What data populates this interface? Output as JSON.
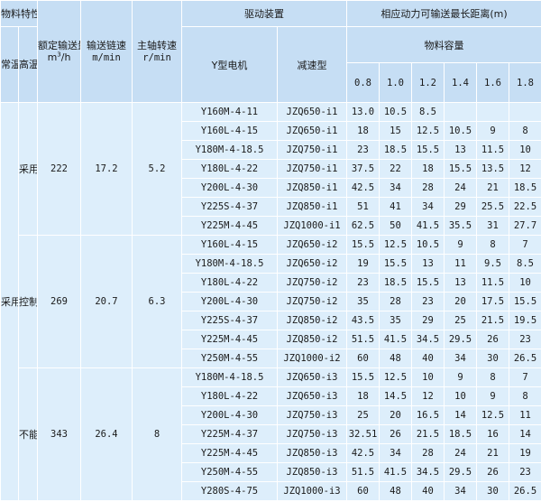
{
  "header": {
    "material_prop": "物料特性",
    "temp_normal": "常温琢磨性小",
    "temp_high": "高温琢磨性大",
    "rated_volume": "额定输送量",
    "rated_volume_unit_pre": "m",
    "rated_volume_unit_sup": "3",
    "rated_volume_unit_post": "/h",
    "chain_speed": "输送链速",
    "chain_speed_unit": "m/min",
    "spindle_speed": "主轴转速",
    "spindle_speed_unit": "r/min",
    "drive": "驱动装置",
    "motor": "Y型电机",
    "reducer": "减速型",
    "max_distance": "相应动力可输送最长距离(m)",
    "capacity": "物料容量",
    "capacity_values": [
      "0.8",
      "1.0",
      "1.2",
      "1.4",
      "1.6",
      "1.8"
    ]
  },
  "col_normal_label": "采用",
  "groups": [
    {
      "high_temp_label": "采用",
      "volume": "222",
      "chain_speed": "17.2",
      "spindle_speed": "5.2",
      "rows": [
        {
          "motor": "Y160M-4-11",
          "reducer": "JZQ650-i1",
          "values": [
            "13.0",
            "10.5",
            "8.5",
            "",
            "",
            ""
          ]
        },
        {
          "motor": "Y160L-4-15",
          "reducer": "JZQ650-i1",
          "values": [
            "18",
            "15",
            "12.5",
            "10.5",
            "9",
            "8"
          ]
        },
        {
          "motor": "Y180M-4-18.5",
          "reducer": "JZQ750-i1",
          "values": [
            "23",
            "18.5",
            "15.5",
            "13",
            "11.5",
            "10"
          ]
        },
        {
          "motor": "Y180L-4-22",
          "reducer": "JZQ750-i1",
          "values": [
            "37.5",
            "22",
            "18",
            "15.5",
            "13.5",
            "12"
          ]
        },
        {
          "motor": "Y200L-4-30",
          "reducer": "JZQ850-i1",
          "values": [
            "42.5",
            "34",
            "28",
            "24",
            "21",
            "18.5"
          ]
        },
        {
          "motor": "Y225S-4-37",
          "reducer": "JZQ850-i1",
          "values": [
            "51",
            "41",
            "34",
            "29",
            "25.5",
            "22.5"
          ]
        },
        {
          "motor": "Y225M-4-45",
          "reducer": "JZQ1000-i1",
          "values": [
            "62.5",
            "50",
            "41.5",
            "35.5",
            "31",
            "27.7"
          ]
        }
      ]
    },
    {
      "high_temp_label": "控制采用",
      "volume": "269",
      "chain_speed": "20.7",
      "spindle_speed": "6.3",
      "rows": [
        {
          "motor": "Y160L-4-15",
          "reducer": "JZQ650-i2",
          "values": [
            "15.5",
            "12.5",
            "10.5",
            "9",
            "8",
            "7"
          ]
        },
        {
          "motor": "Y180M-4-18.5",
          "reducer": "JZQ650-i2",
          "values": [
            "19",
            "15.5",
            "13",
            "11",
            "9.5",
            "8.5"
          ]
        },
        {
          "motor": "Y180L-4-22",
          "reducer": "JZQ750-i2",
          "values": [
            "23",
            "18.5",
            "15.5",
            "13",
            "11.5",
            "10"
          ]
        },
        {
          "motor": "Y200L-4-30",
          "reducer": "JZQ750-i2",
          "values": [
            "35",
            "28",
            "23",
            "20",
            "17.5",
            "15.5"
          ]
        },
        {
          "motor": "Y225S-4-37",
          "reducer": "JZQ850-i2",
          "values": [
            "43.5",
            "35",
            "29",
            "25",
            "21.5",
            "19.5"
          ]
        },
        {
          "motor": "Y225M-4-45",
          "reducer": "JZQ850-i2",
          "values": [
            "51.5",
            "41.5",
            "34.5",
            "29.5",
            "26",
            "23"
          ]
        },
        {
          "motor": "Y250M-4-55",
          "reducer": "JZQ1000-i2",
          "values": [
            "60",
            "48",
            "40",
            "34",
            "30",
            "26.5"
          ]
        }
      ]
    },
    {
      "high_temp_label": "不能采用",
      "volume": "343",
      "chain_speed": "26.4",
      "spindle_speed": "8",
      "rows": [
        {
          "motor": "Y180M-4-18.5",
          "reducer": "JZQ650-i3",
          "values": [
            "15.5",
            "12.5",
            "10",
            "9",
            "8",
            "7"
          ]
        },
        {
          "motor": "Y180L-4-22",
          "reducer": "JZQ650-i3",
          "values": [
            "18",
            "14.5",
            "12",
            "10",
            "9",
            "8"
          ]
        },
        {
          "motor": "Y200L-4-30",
          "reducer": "JZQ750-i3",
          "values": [
            "25",
            "20",
            "16.5",
            "14",
            "12.5",
            "11"
          ]
        },
        {
          "motor": "Y225M-4-37",
          "reducer": "JZQ750-i3",
          "values": [
            "32.51",
            "26",
            "21.5",
            "18.5",
            "16",
            "14"
          ]
        },
        {
          "motor": "Y225M-4-45",
          "reducer": "JZQ850-i3",
          "values": [
            "42.5",
            "34",
            "28",
            "24",
            "21",
            "19"
          ]
        },
        {
          "motor": "Y250M-4-55",
          "reducer": "JZQ850-i3",
          "values": [
            "51.5",
            "41.5",
            "34.5",
            "29.5",
            "26",
            "23"
          ]
        },
        {
          "motor": "Y280S-4-75",
          "reducer": "JZQ1000-i3",
          "values": [
            "60",
            "48",
            "40",
            "34",
            "30",
            "26.5"
          ]
        }
      ]
    }
  ]
}
